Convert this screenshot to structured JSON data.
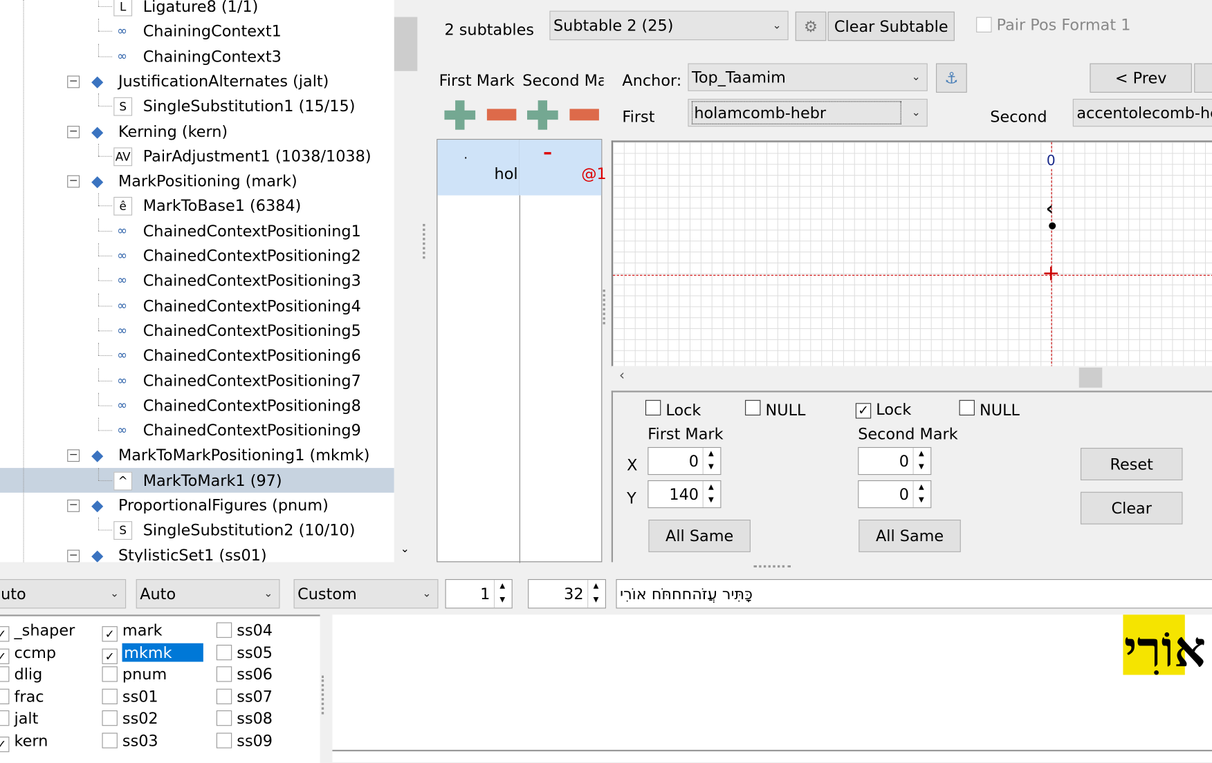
{
  "tree": {
    "items": [
      {
        "label": "Ligature8 (1/1)",
        "level": 2,
        "icon": "L"
      },
      {
        "label": "ChainingContext1",
        "level": 2,
        "icon": "chain"
      },
      {
        "label": "ChainingContext3",
        "level": 2,
        "icon": "chain"
      },
      {
        "label": "JustificationAlternates (jalt)",
        "level": 1,
        "icon": "feature"
      },
      {
        "label": "SingleSubstitution1 (15/15)",
        "level": 2,
        "icon": "S"
      },
      {
        "label": "Kerning (kern)",
        "level": 1,
        "icon": "feature"
      },
      {
        "label": "PairAdjustment1 (1038/1038)",
        "level": 2,
        "icon": "AV"
      },
      {
        "label": "MarkPositioning (mark)",
        "level": 1,
        "icon": "feature"
      },
      {
        "label": "MarkToBase1 (6384)",
        "level": 2,
        "icon": "ê"
      },
      {
        "label": "ChainedContextPositioning1",
        "level": 2,
        "icon": "chain"
      },
      {
        "label": "ChainedContextPositioning2",
        "level": 2,
        "icon": "chain"
      },
      {
        "label": "ChainedContextPositioning3",
        "level": 2,
        "icon": "chain"
      },
      {
        "label": "ChainedContextPositioning4",
        "level": 2,
        "icon": "chain"
      },
      {
        "label": "ChainedContextPositioning5",
        "level": 2,
        "icon": "chain"
      },
      {
        "label": "ChainedContextPositioning6",
        "level": 2,
        "icon": "chain"
      },
      {
        "label": "ChainedContextPositioning7",
        "level": 2,
        "icon": "chain"
      },
      {
        "label": "ChainedContextPositioning8",
        "level": 2,
        "icon": "chain"
      },
      {
        "label": "ChainedContextPositioning9",
        "level": 2,
        "icon": "chain"
      },
      {
        "label": "MarkToMarkPositioning1 (mkmk)",
        "level": 1,
        "icon": "feature"
      },
      {
        "label": "MarkToMark1 (97)",
        "level": 2,
        "icon": "^",
        "selected": true
      },
      {
        "label": "ProportionalFigures (pnum)",
        "level": 1,
        "icon": "feature"
      },
      {
        "label": "SingleSubstitution2 (10/10)",
        "level": 2,
        "icon": "S"
      },
      {
        "label": "StylisticSet1 (ss01)",
        "level": 1,
        "icon": "feature"
      }
    ]
  },
  "subtable": {
    "count_label": "2 subtables",
    "selected": "Subtable 2 (25)",
    "clear_label": "Clear Subtable",
    "pair_pos_label": "Pair Pos Format 1",
    "pair_pos_checked": false
  },
  "marks": {
    "first_header": "First Mark",
    "second_header": "Second Ma",
    "first_cell": "hol",
    "second_cell": "@1"
  },
  "anchor": {
    "label": "Anchor:",
    "value": "Top_Taamim",
    "prev_label": "< Prev"
  },
  "glyphs": {
    "first_label": "First",
    "first_value": "holamcomb-hebr",
    "second_label": "Second",
    "second_value": "accentolecomb-he"
  },
  "canvas": {
    "origin_label": "0"
  },
  "editor": {
    "first": {
      "lock_label": "Lock",
      "lock_checked": false,
      "null_label": "NULL",
      "null_checked": false,
      "title": "First Mark",
      "x": "0",
      "y": "140",
      "all_same": "All Same"
    },
    "second": {
      "lock_label": "Lock",
      "lock_checked": true,
      "null_label": "NULL",
      "null_checked": false,
      "title": "Second Mark",
      "x": "0",
      "y": "0",
      "all_same": "All Same"
    },
    "x_label": "X",
    "y_label": "Y",
    "reset_label": "Reset",
    "clear_label": "Clear"
  },
  "toolbar": {
    "script": "uto",
    "language": "Auto",
    "mode": "Custom",
    "count": "1",
    "size": "32",
    "text": "כָּתִּיר עֲזֹהחחחֹּח אוֹרִי"
  },
  "features": {
    "col1": [
      {
        "label": "_shaper",
        "checked": true
      },
      {
        "label": "ccmp",
        "checked": true
      },
      {
        "label": "dlig",
        "checked": false
      },
      {
        "label": "frac",
        "checked": false
      },
      {
        "label": "jalt",
        "checked": false
      },
      {
        "label": "kern",
        "checked": true
      }
    ],
    "col2": [
      {
        "label": "mark",
        "checked": true
      },
      {
        "label": "mkmk",
        "checked": true,
        "selected": true
      },
      {
        "label": "pnum",
        "checked": false
      },
      {
        "label": "ss01",
        "checked": false
      },
      {
        "label": "ss02",
        "checked": false
      },
      {
        "label": "ss03",
        "checked": false
      }
    ],
    "col3": [
      {
        "label": "ss04",
        "checked": false
      },
      {
        "label": "ss05",
        "checked": false
      },
      {
        "label": "ss06",
        "checked": false
      },
      {
        "label": "ss07",
        "checked": false
      },
      {
        "label": "ss08",
        "checked": false
      },
      {
        "label": "ss09",
        "checked": false
      }
    ]
  },
  "preview": {
    "text": "אוֹרִי",
    "highlight_color": "#f5e400"
  },
  "colors": {
    "add": "#74a892",
    "remove": "#dd6a4a",
    "selection": "#0078d7",
    "tree_selection": "#c7d3e0",
    "guide": "#cc0000"
  }
}
